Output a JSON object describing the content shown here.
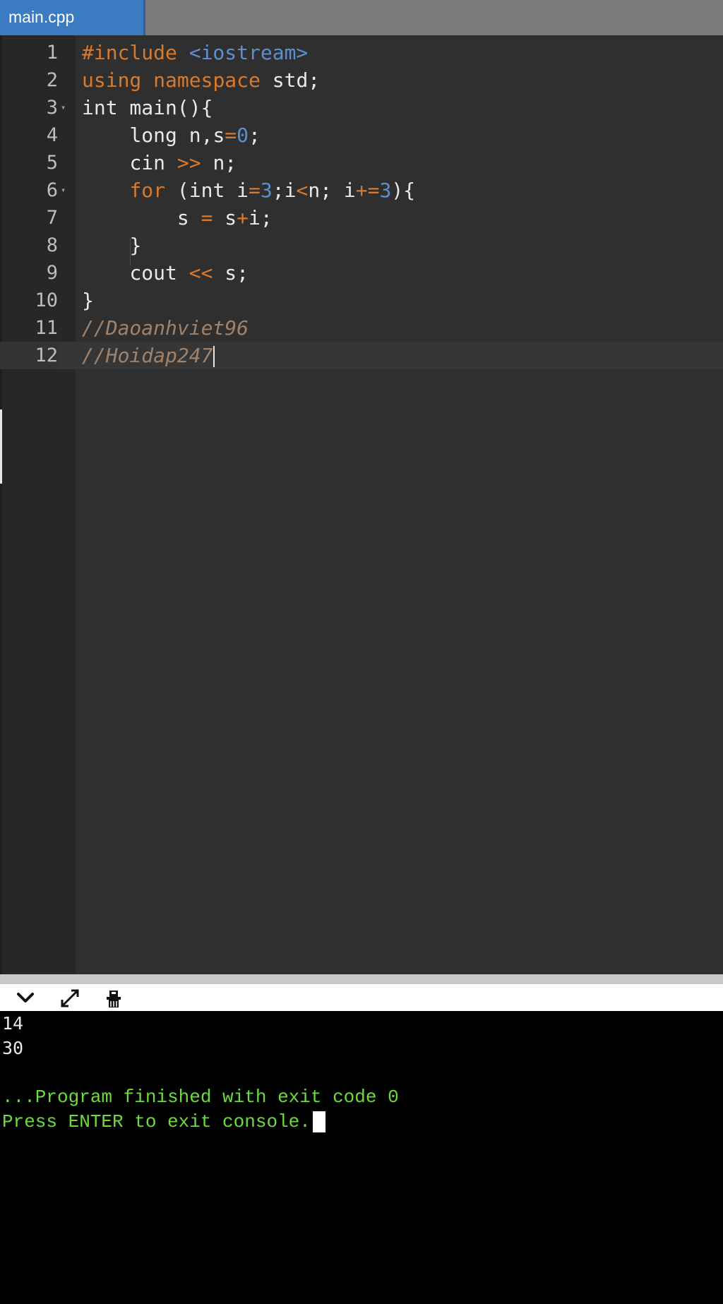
{
  "tabs": [
    {
      "label": "main.cpp",
      "active": true
    }
  ],
  "editor": {
    "lines": [
      {
        "num": "1",
        "fold": ""
      },
      {
        "num": "2",
        "fold": ""
      },
      {
        "num": "3",
        "fold": "▾"
      },
      {
        "num": "4",
        "fold": ""
      },
      {
        "num": "5",
        "fold": ""
      },
      {
        "num": "6",
        "fold": "▾"
      },
      {
        "num": "7",
        "fold": ""
      },
      {
        "num": "8",
        "fold": ""
      },
      {
        "num": "9",
        "fold": ""
      },
      {
        "num": "10",
        "fold": ""
      },
      {
        "num": "11",
        "fold": ""
      },
      {
        "num": "12",
        "fold": ""
      }
    ],
    "code": {
      "l1_kw": "#include",
      "l1_str": "<iostream>",
      "l2_kw1": "using",
      "l2_kw2": "namespace",
      "l2_rest": "std;",
      "l3": "int main(){",
      "l4_a": "long n,s",
      "l4_op": "=",
      "l4_num": "0",
      "l4_b": ";",
      "l5_a": "cin ",
      "l5_op": ">>",
      "l5_b": " n;",
      "l6_kw": "for",
      "l6_a": " (int i",
      "l6_op1": "=",
      "l6_num1": "3",
      "l6_b": ";i",
      "l6_op2": "<",
      "l6_c": "n; i",
      "l6_op3": "+=",
      "l6_num2": "3",
      "l6_d": "){",
      "l7_a": "s ",
      "l7_op1": "=",
      "l7_b": " s",
      "l7_op2": "+",
      "l7_c": "i;",
      "l8": "}",
      "l9_a": "cout ",
      "l9_op": "<<",
      "l9_b": " s;",
      "l10": "}",
      "l11": "//Daoanhviet96",
      "l12": "//Hoidap247"
    },
    "colors": {
      "keyword": "#d87a2e",
      "string": "#5b8fd0",
      "comment": "#a0826a"
    }
  },
  "console_toolbar": {
    "icons": [
      "chevron-down-icon",
      "expand-icon",
      "clear-console-icon"
    ]
  },
  "console": {
    "output": [
      "14",
      "30"
    ],
    "finish_msg": "...Program finished with exit code 0",
    "press_msg": "Press ENTER to exit console."
  }
}
